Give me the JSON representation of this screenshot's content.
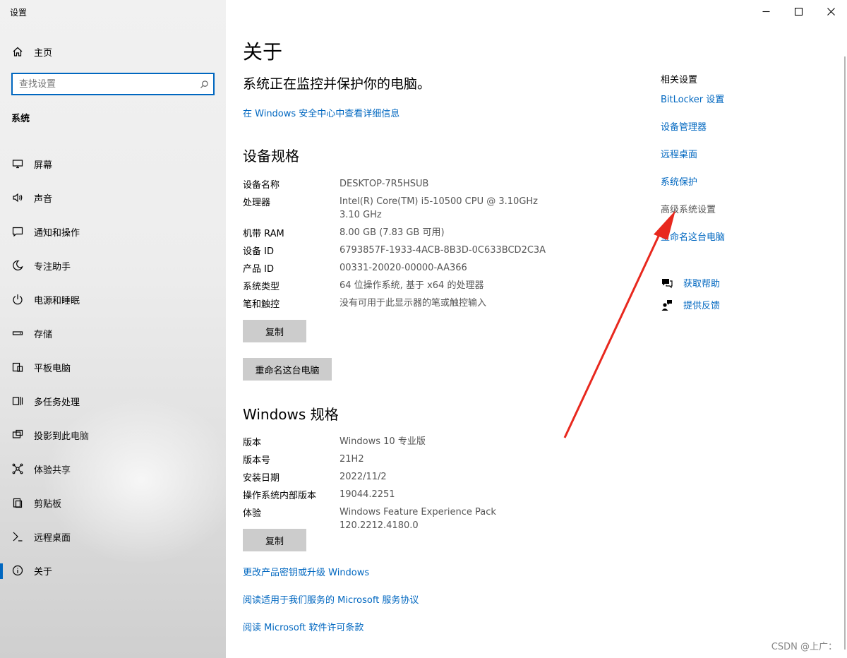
{
  "window": {
    "title": "设置",
    "controls": [
      "minimize-icon",
      "maximize-icon",
      "close-icon"
    ]
  },
  "sidebar": {
    "home": {
      "label": "主页",
      "icon": "home-icon"
    },
    "search": {
      "placeholder": "查找设置",
      "value": "",
      "icon": "search-icon"
    },
    "section": "系统",
    "items": [
      {
        "label": "屏幕",
        "icon": "display-icon",
        "active": false
      },
      {
        "label": "声音",
        "icon": "speaker-icon",
        "active": false
      },
      {
        "label": "通知和操作",
        "icon": "notification-icon",
        "active": false
      },
      {
        "label": "专注助手",
        "icon": "moon-icon",
        "active": false
      },
      {
        "label": "电源和睡眠",
        "icon": "power-icon",
        "active": false
      },
      {
        "label": "存储",
        "icon": "storage-icon",
        "active": false
      },
      {
        "label": "平板电脑",
        "icon": "tablet-icon",
        "active": false
      },
      {
        "label": "多任务处理",
        "icon": "multitask-icon",
        "active": false
      },
      {
        "label": "投影到此电脑",
        "icon": "project-icon",
        "active": false
      },
      {
        "label": "体验共享",
        "icon": "share-icon",
        "active": false
      },
      {
        "label": "剪贴板",
        "icon": "clipboard-icon",
        "active": false
      },
      {
        "label": "远程桌面",
        "icon": "remote-desktop-icon",
        "active": false
      },
      {
        "label": "关于",
        "icon": "info-icon",
        "active": true
      }
    ]
  },
  "main": {
    "title": "关于",
    "protect_text": "系统正在监控并保护你的电脑。",
    "security_link": "在 Windows 安全中心中查看详细信息",
    "device_specs": {
      "heading": "设备规格",
      "rows": [
        {
          "key": "设备名称",
          "value": "DESKTOP-7R5HSUB"
        },
        {
          "key": "处理器",
          "value": "Intel(R) Core(TM) i5-10500 CPU @ 3.10GHz   3.10 GHz"
        },
        {
          "key": "机带 RAM",
          "value": "8.00 GB (7.83 GB 可用)"
        },
        {
          "key": "设备 ID",
          "value": "6793857F-1933-4ACB-8B3D-0C633BCD2C3A"
        },
        {
          "key": "产品 ID",
          "value": "00331-20020-00000-AA366"
        },
        {
          "key": "系统类型",
          "value": "64 位操作系统, 基于 x64 的处理器"
        },
        {
          "key": "笔和触控",
          "value": "没有可用于此显示器的笔或触控输入"
        }
      ],
      "copy_label": "复制",
      "rename_label": "重命名这台电脑"
    },
    "windows_specs": {
      "heading": "Windows 规格",
      "rows": [
        {
          "key": "版本",
          "value": "Windows 10 专业版"
        },
        {
          "key": "版本号",
          "value": "21H2"
        },
        {
          "key": "安装日期",
          "value": "2022/11/2"
        },
        {
          "key": "操作系统内部版本",
          "value": "19044.2251"
        },
        {
          "key": "体验",
          "value": "Windows Feature Experience Pack 120.2212.4180.0"
        }
      ],
      "copy_label": "复制"
    },
    "bottom_links": [
      "更改产品密钥或升级 Windows",
      "阅读适用于我们服务的 Microsoft 服务协议",
      "阅读 Microsoft 软件许可条款"
    ]
  },
  "related": {
    "title": "相关设置",
    "items": [
      {
        "label": "BitLocker 设置",
        "enabled": true
      },
      {
        "label": "设备管理器",
        "enabled": true
      },
      {
        "label": "远程桌面",
        "enabled": true
      },
      {
        "label": "系统保护",
        "enabled": true
      },
      {
        "label": "高级系统设置",
        "enabled": false
      },
      {
        "label": "重命名这台电脑",
        "enabled": true
      }
    ],
    "help": [
      {
        "label": "获取帮助",
        "icon": "chat-help-icon"
      },
      {
        "label": "提供反馈",
        "icon": "feedback-icon"
      }
    ]
  },
  "annotation": {
    "arrow_color": "#e8281e"
  },
  "theme": {
    "accent": "#0067c0",
    "link": "#0067c0",
    "button_bg": "#cccccc"
  },
  "watermark": "CSDN @上广："
}
